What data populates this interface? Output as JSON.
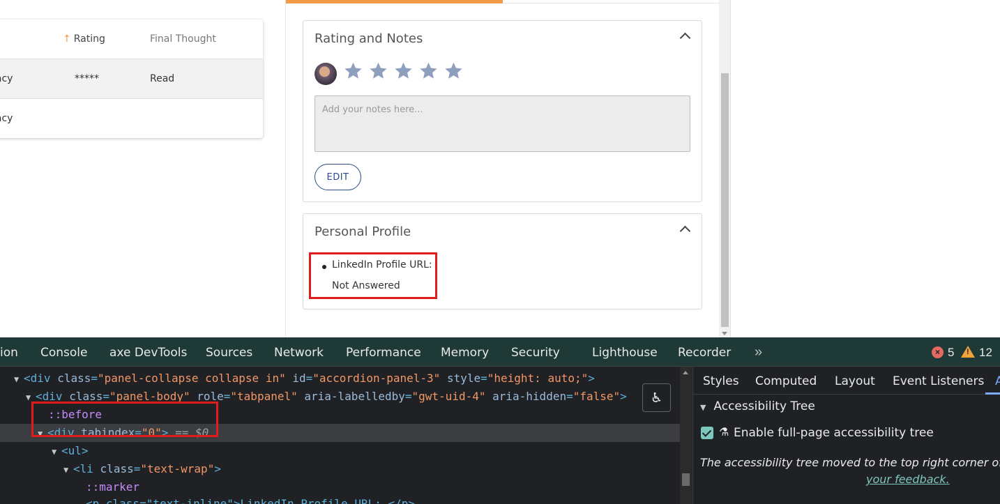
{
  "table": {
    "headers": {
      "rating_arrow": "↑",
      "rating": "Rating",
      "final_thought": "Final Thought"
    },
    "rows": [
      {
        "col1": "lacy",
        "rating": "*****",
        "final_thought": "Read"
      },
      {
        "col1": "lacy",
        "rating": "",
        "final_thought": ""
      }
    ]
  },
  "rating_panel": {
    "title": "Rating and Notes",
    "star_count": 5,
    "notes_placeholder": "Add your notes here...",
    "edit_label": "EDIT"
  },
  "profile_panel": {
    "title": "Personal Profile",
    "linkedin_label": "LinkedIn Profile URL:",
    "linkedin_value": "Not Answered"
  },
  "devtools": {
    "tabs": [
      "ion",
      "Console",
      "axe DevTools",
      "Sources",
      "Network",
      "Performance",
      "Memory",
      "Security",
      "Lighthouse",
      "Recorder"
    ],
    "more": "»",
    "errors": "5",
    "warnings": "12",
    "code": {
      "l1_tag": "div",
      "l1_class": "\"panel-collapse collapse in\"",
      "l1_id": "\"accordion-panel-3\"",
      "l1_style": "\"height: auto;\"",
      "l2_tag": "div",
      "l2_class": "\"panel-body\"",
      "l2_role": "\"tabpanel\"",
      "l2_labelledby": "\"gwt-uid-4\"",
      "l2_hidden": "\"false\"",
      "before": "::before",
      "l4_tag": "div",
      "l4_tabindex": "\"0\"",
      "l4_ref": "== $0",
      "l5_tag": "ul",
      "l6_tag": "li",
      "l6_class": "\"text-wrap\"",
      "marker": "::marker",
      "l8_text": "<p class=\"text-inline\">LinkedIn Profile URL: </p>"
    },
    "side_tabs": [
      "Styles",
      "Computed",
      "Layout",
      "Event Listeners",
      "A"
    ],
    "tree_header": "Accessibility Tree",
    "enable_label": "Enable full-page accessibility tree",
    "moved_text": "The accessibility tree moved to the top right corner of th",
    "feedback_link": "your feedback."
  },
  "colors": {
    "accent": "#f39a47",
    "highlight_box": "#e21b1b",
    "star": "#8fa0bf",
    "edit_button": "#2c4a8a"
  }
}
